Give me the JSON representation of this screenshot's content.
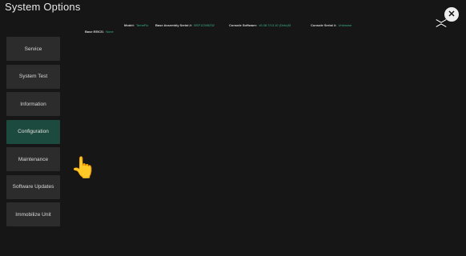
{
  "header": {
    "title": "System Options"
  },
  "info_bar": {
    "model": {
      "label": "Model:",
      "value": "TemeFlo"
    },
    "base_assembly_serial": {
      "label": "Base Assembly Serial #:",
      "value": "BSF12345232"
    },
    "console_software": {
      "label": "Console Software:",
      "value": "v5.08.7/13.10 (Octo)f3"
    },
    "console_serial": {
      "label": "Console Serial #:",
      "value": "Unknown"
    },
    "base_eeics": {
      "label": "Base EEICS:",
      "value": "None"
    }
  },
  "sidebar": {
    "items": [
      {
        "label": "Service",
        "active": false
      },
      {
        "label": "System Test",
        "active": false
      },
      {
        "label": "Information",
        "active": false
      },
      {
        "label": "Configuration",
        "active": true
      },
      {
        "label": "Maintenance",
        "active": false
      },
      {
        "label": "Software Updates",
        "active": false
      },
      {
        "label": "Immobilize Unit",
        "active": false
      }
    ]
  },
  "icons": {
    "close": "close-icon",
    "pointer": "pointing-hand-icon",
    "watermark": "capcut-logo-icon"
  },
  "colors": {
    "background": "#161616",
    "button": "#2c2c2c",
    "active_button": "#1d4a3e",
    "value_text": "#3bb58e"
  }
}
